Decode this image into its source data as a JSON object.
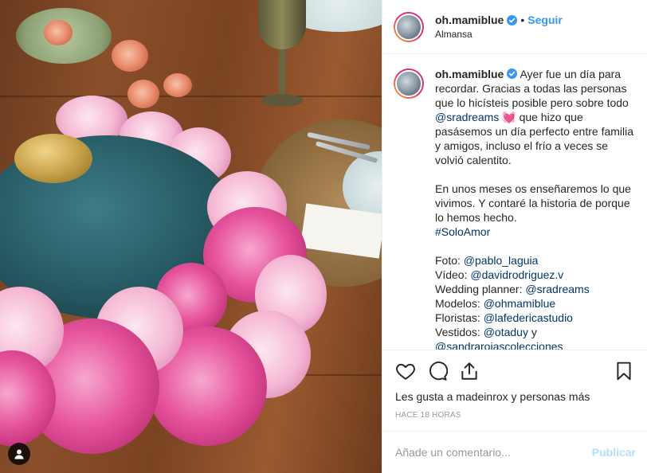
{
  "header": {
    "username": "oh.mamiblue",
    "separator": "•",
    "follow_label": "Seguir",
    "location": "Almansa"
  },
  "caption": {
    "username": "oh.mamiblue",
    "line1_text": " Ayer fue un día para recordar. Gracias a todas las personas que lo hicísteis posible pero sobre todo ",
    "mention_sradreams": "@sradreams",
    "heart_emoji": " 💓 ",
    "line1_rest": "que hizo que pasásemos un día perfecto entre familia y amigos, incluso el frío a veces se volvió calentito.",
    "para2": "En unos meses os enseñaremos lo que vivimos. Y contaré la historia de porque lo hemos hecho.",
    "hashtag": "#SoloAmor",
    "credits": [
      {
        "label": "Foto: ",
        "mention": "@pablo_laguia"
      },
      {
        "label": "Vídeo: ",
        "mention": "@davidrodriguez.v"
      },
      {
        "label": "Wedding planner: ",
        "mention": "@sradreams"
      },
      {
        "label": "Modelos: ",
        "mention": "@ohmamiblue"
      },
      {
        "label": "Floristas: ",
        "mention": "@lafedericastudio"
      },
      {
        "label": "Vestidos: ",
        "mention": "@otaduy",
        "suffix": " y"
      },
      {
        "label": "",
        "mention": "@sandrarojascolecciones"
      }
    ]
  },
  "actions": {
    "likes_text": "Les gusta a madeinrox y personas más",
    "timestamp": "HACE 18 HORAS"
  },
  "comment_box": {
    "placeholder": "Añade un comentario...",
    "post_label": "Publicar"
  },
  "icons": {
    "like": "heart-icon",
    "comment": "comment-icon",
    "share": "share-icon",
    "save": "bookmark-icon",
    "verified": "verified-badge-icon",
    "user_tag": "user-tag-icon"
  },
  "colors": {
    "link": "#3897f0",
    "mention": "#003569",
    "post_disabled": "#b2dffc",
    "meta": "#999999"
  }
}
